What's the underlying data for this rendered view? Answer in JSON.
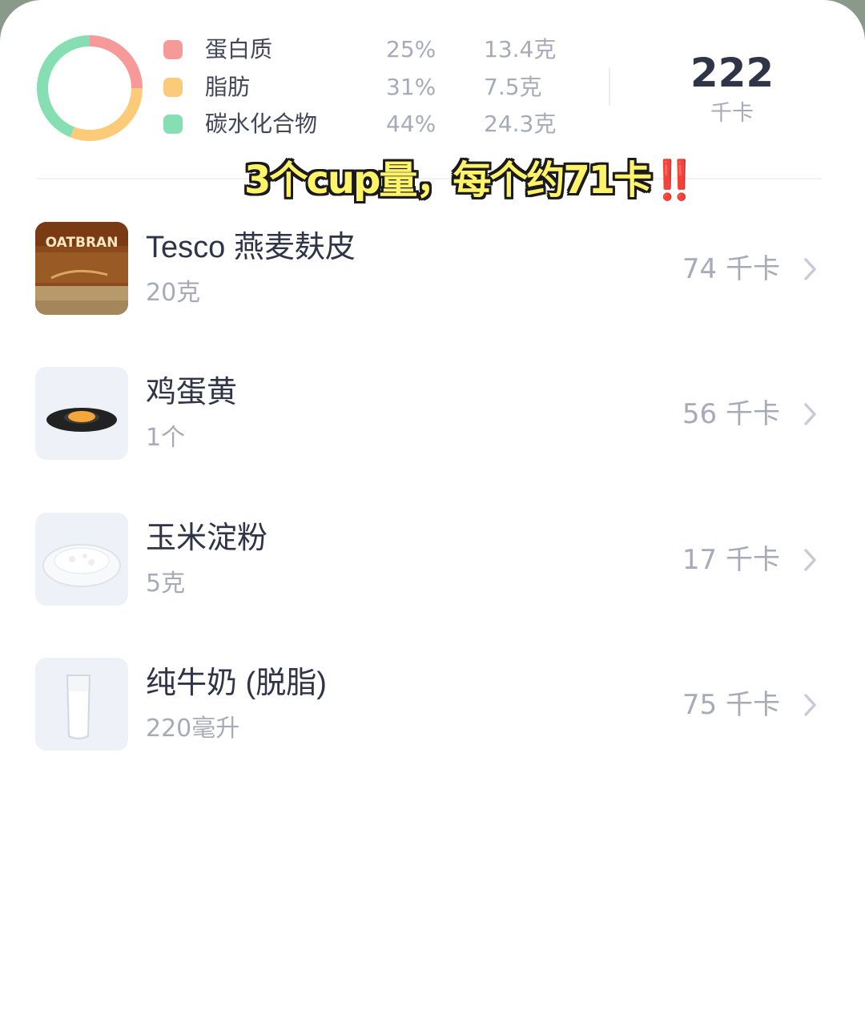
{
  "summary": {
    "macros": [
      {
        "name": "蛋白质",
        "percent": "25%",
        "amount": "13.4克",
        "color": "#f59a98"
      },
      {
        "name": "脂肪",
        "percent": "31%",
        "amount": "7.5克",
        "color": "#fccb79"
      },
      {
        "name": "碳水化合物",
        "percent": "44%",
        "amount": "24.3克",
        "color": "#85dfb2"
      }
    ],
    "total_kcal": "222",
    "total_unit": "千卡"
  },
  "overlay": {
    "text": "3个cup量，每个约71卡",
    "emoji": "‼️"
  },
  "foods": [
    {
      "name": "Tesco 燕麦麸皮",
      "qty": "20克",
      "kcal": "74 千卡",
      "thumb": "oatbran-pack"
    },
    {
      "name": "鸡蛋黄",
      "qty": "1个",
      "kcal": "56 千卡",
      "thumb": "egg-yolk-plate"
    },
    {
      "name": "玉米淀粉",
      "qty": "5克",
      "kcal": "17 千卡",
      "thumb": "cornstarch-plate"
    },
    {
      "name": "纯牛奶 (脱脂)",
      "qty": "220毫升",
      "kcal": "75 千卡",
      "thumb": "milk-glass"
    }
  ]
}
